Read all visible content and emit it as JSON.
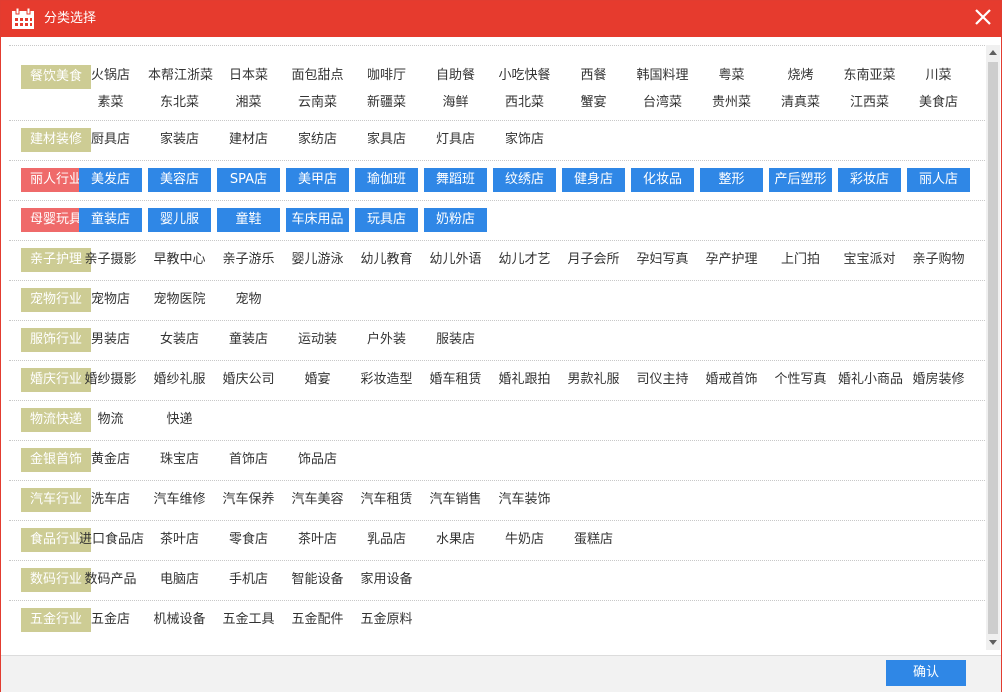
{
  "title": "分类选择",
  "confirm_label": "确认",
  "colors": {
    "titlebar": "#e63b2e",
    "category": "#cdcc94",
    "category_selected": "#ef6a6a",
    "item_selected": "#2f87e6"
  },
  "icons": {
    "title": "calendar-icon",
    "close": "close-icon"
  },
  "categories": [
    {
      "name": "餐饮美食",
      "selected": false,
      "items": [
        {
          "label": "火锅店",
          "selected": false
        },
        {
          "label": "本帮江浙菜",
          "selected": false
        },
        {
          "label": "日本菜",
          "selected": false
        },
        {
          "label": "面包甜点",
          "selected": false
        },
        {
          "label": "咖啡厅",
          "selected": false
        },
        {
          "label": "自助餐",
          "selected": false
        },
        {
          "label": "小吃快餐",
          "selected": false
        },
        {
          "label": "西餐",
          "selected": false
        },
        {
          "label": "韩国料理",
          "selected": false
        },
        {
          "label": "粤菜",
          "selected": false
        },
        {
          "label": "烧烤",
          "selected": false
        },
        {
          "label": "东南亚菜",
          "selected": false
        },
        {
          "label": "川菜",
          "selected": false
        },
        {
          "label": "素菜",
          "selected": false
        },
        {
          "label": "东北菜",
          "selected": false
        },
        {
          "label": "湘菜",
          "selected": false
        },
        {
          "label": "云南菜",
          "selected": false
        },
        {
          "label": "新疆菜",
          "selected": false
        },
        {
          "label": "海鲜",
          "selected": false
        },
        {
          "label": "西北菜",
          "selected": false
        },
        {
          "label": "蟹宴",
          "selected": false
        },
        {
          "label": "台湾菜",
          "selected": false
        },
        {
          "label": "贵州菜",
          "selected": false
        },
        {
          "label": "清真菜",
          "selected": false
        },
        {
          "label": "江西菜",
          "selected": false
        },
        {
          "label": "美食店",
          "selected": false
        }
      ]
    },
    {
      "name": "建材装修",
      "selected": false,
      "items": [
        {
          "label": "厨具店",
          "selected": false
        },
        {
          "label": "家装店",
          "selected": false
        },
        {
          "label": "建材店",
          "selected": false
        },
        {
          "label": "家纺店",
          "selected": false
        },
        {
          "label": "家具店",
          "selected": false
        },
        {
          "label": "灯具店",
          "selected": false
        },
        {
          "label": "家饰店",
          "selected": false
        }
      ]
    },
    {
      "name": "丽人行业",
      "selected": true,
      "items": [
        {
          "label": "美发店",
          "selected": true
        },
        {
          "label": "美容店",
          "selected": true
        },
        {
          "label": "SPA店",
          "selected": true
        },
        {
          "label": "美甲店",
          "selected": true
        },
        {
          "label": "瑜伽班",
          "selected": true
        },
        {
          "label": "舞蹈班",
          "selected": true
        },
        {
          "label": "纹绣店",
          "selected": true
        },
        {
          "label": "健身店",
          "selected": true
        },
        {
          "label": "化妆品",
          "selected": true
        },
        {
          "label": "整形",
          "selected": true
        },
        {
          "label": "产后塑形",
          "selected": true
        },
        {
          "label": "彩妆店",
          "selected": true
        },
        {
          "label": "丽人店",
          "selected": true
        }
      ]
    },
    {
      "name": "母婴玩具",
      "selected": true,
      "items": [
        {
          "label": "童装店",
          "selected": true
        },
        {
          "label": "婴儿服",
          "selected": true
        },
        {
          "label": "童鞋",
          "selected": true
        },
        {
          "label": "车床用品",
          "selected": true
        },
        {
          "label": "玩具店",
          "selected": true
        },
        {
          "label": "奶粉店",
          "selected": true
        }
      ]
    },
    {
      "name": "亲子护理",
      "selected": false,
      "items": [
        {
          "label": "亲子摄影",
          "selected": false
        },
        {
          "label": "早教中心",
          "selected": false
        },
        {
          "label": "亲子游乐",
          "selected": false
        },
        {
          "label": "婴儿游泳",
          "selected": false
        },
        {
          "label": "幼儿教育",
          "selected": false
        },
        {
          "label": "幼儿外语",
          "selected": false
        },
        {
          "label": "幼儿才艺",
          "selected": false
        },
        {
          "label": "月子会所",
          "selected": false
        },
        {
          "label": "孕妇写真",
          "selected": false
        },
        {
          "label": "孕产护理",
          "selected": false
        },
        {
          "label": "上门拍",
          "selected": false
        },
        {
          "label": "宝宝派对",
          "selected": false
        },
        {
          "label": "亲子购物",
          "selected": false
        }
      ]
    },
    {
      "name": "宠物行业",
      "selected": false,
      "items": [
        {
          "label": "宠物店",
          "selected": false
        },
        {
          "label": "宠物医院",
          "selected": false
        },
        {
          "label": "宠物",
          "selected": false
        }
      ]
    },
    {
      "name": "服饰行业",
      "selected": false,
      "items": [
        {
          "label": "男装店",
          "selected": false
        },
        {
          "label": "女装店",
          "selected": false
        },
        {
          "label": "童装店",
          "selected": false
        },
        {
          "label": "运动装",
          "selected": false
        },
        {
          "label": "户外装",
          "selected": false
        },
        {
          "label": "服装店",
          "selected": false
        }
      ]
    },
    {
      "name": "婚庆行业",
      "selected": false,
      "items": [
        {
          "label": "婚纱摄影",
          "selected": false
        },
        {
          "label": "婚纱礼服",
          "selected": false
        },
        {
          "label": "婚庆公司",
          "selected": false
        },
        {
          "label": "婚宴",
          "selected": false
        },
        {
          "label": "彩妆造型",
          "selected": false
        },
        {
          "label": "婚车租赁",
          "selected": false
        },
        {
          "label": "婚礼跟拍",
          "selected": false
        },
        {
          "label": "男款礼服",
          "selected": false
        },
        {
          "label": "司仪主持",
          "selected": false
        },
        {
          "label": "婚戒首饰",
          "selected": false
        },
        {
          "label": "个性写真",
          "selected": false
        },
        {
          "label": "婚礼小商品",
          "selected": false
        },
        {
          "label": "婚房装修",
          "selected": false
        }
      ]
    },
    {
      "name": "物流快递",
      "selected": false,
      "items": [
        {
          "label": "物流",
          "selected": false
        },
        {
          "label": "快递",
          "selected": false
        }
      ]
    },
    {
      "name": "金银首饰",
      "selected": false,
      "items": [
        {
          "label": "黄金店",
          "selected": false
        },
        {
          "label": "珠宝店",
          "selected": false
        },
        {
          "label": "首饰店",
          "selected": false
        },
        {
          "label": "饰品店",
          "selected": false
        }
      ]
    },
    {
      "name": "汽车行业",
      "selected": false,
      "items": [
        {
          "label": "洗车店",
          "selected": false
        },
        {
          "label": "汽车维修",
          "selected": false
        },
        {
          "label": "汽车保养",
          "selected": false
        },
        {
          "label": "汽车美容",
          "selected": false
        },
        {
          "label": "汽车租赁",
          "selected": false
        },
        {
          "label": "汽车销售",
          "selected": false
        },
        {
          "label": "汽车装饰",
          "selected": false
        }
      ]
    },
    {
      "name": "食品行业",
      "selected": false,
      "items": [
        {
          "label": "进口食品店",
          "selected": false
        },
        {
          "label": "茶叶店",
          "selected": false
        },
        {
          "label": "零食店",
          "selected": false
        },
        {
          "label": "茶叶店",
          "selected": false
        },
        {
          "label": "乳品店",
          "selected": false
        },
        {
          "label": "水果店",
          "selected": false
        },
        {
          "label": "牛奶店",
          "selected": false
        },
        {
          "label": "蛋糕店",
          "selected": false
        }
      ]
    },
    {
      "name": "数码行业",
      "selected": false,
      "items": [
        {
          "label": "数码产品",
          "selected": false
        },
        {
          "label": "电脑店",
          "selected": false
        },
        {
          "label": "手机店",
          "selected": false
        },
        {
          "label": "智能设备",
          "selected": false
        },
        {
          "label": "家用设备",
          "selected": false
        }
      ]
    },
    {
      "name": "五金行业",
      "selected": false,
      "items": [
        {
          "label": "五金店",
          "selected": false
        },
        {
          "label": "机械设备",
          "selected": false
        },
        {
          "label": "五金工具",
          "selected": false
        },
        {
          "label": "五金配件",
          "selected": false
        },
        {
          "label": "五金原料",
          "selected": false
        }
      ]
    }
  ]
}
